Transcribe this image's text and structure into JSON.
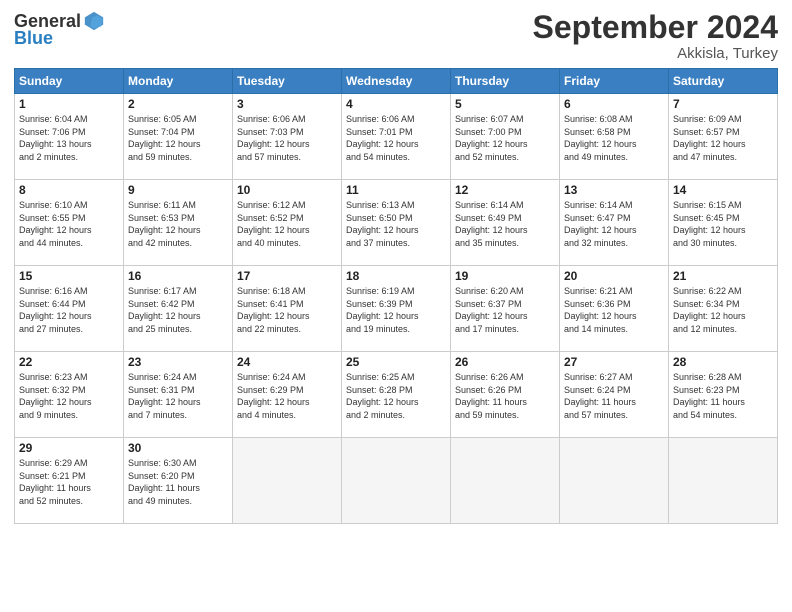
{
  "logo": {
    "general": "General",
    "blue": "Blue"
  },
  "title": "September 2024",
  "location": "Akkisla, Turkey",
  "days_header": [
    "Sunday",
    "Monday",
    "Tuesday",
    "Wednesday",
    "Thursday",
    "Friday",
    "Saturday"
  ],
  "weeks": [
    [
      {
        "day": "1",
        "lines": [
          "Sunrise: 6:04 AM",
          "Sunset: 7:06 PM",
          "Daylight: 13 hours",
          "and 2 minutes."
        ]
      },
      {
        "day": "2",
        "lines": [
          "Sunrise: 6:05 AM",
          "Sunset: 7:04 PM",
          "Daylight: 12 hours",
          "and 59 minutes."
        ]
      },
      {
        "day": "3",
        "lines": [
          "Sunrise: 6:06 AM",
          "Sunset: 7:03 PM",
          "Daylight: 12 hours",
          "and 57 minutes."
        ]
      },
      {
        "day": "4",
        "lines": [
          "Sunrise: 6:06 AM",
          "Sunset: 7:01 PM",
          "Daylight: 12 hours",
          "and 54 minutes."
        ]
      },
      {
        "day": "5",
        "lines": [
          "Sunrise: 6:07 AM",
          "Sunset: 7:00 PM",
          "Daylight: 12 hours",
          "and 52 minutes."
        ]
      },
      {
        "day": "6",
        "lines": [
          "Sunrise: 6:08 AM",
          "Sunset: 6:58 PM",
          "Daylight: 12 hours",
          "and 49 minutes."
        ]
      },
      {
        "day": "7",
        "lines": [
          "Sunrise: 6:09 AM",
          "Sunset: 6:57 PM",
          "Daylight: 12 hours",
          "and 47 minutes."
        ]
      }
    ],
    [
      {
        "day": "8",
        "lines": [
          "Sunrise: 6:10 AM",
          "Sunset: 6:55 PM",
          "Daylight: 12 hours",
          "and 44 minutes."
        ]
      },
      {
        "day": "9",
        "lines": [
          "Sunrise: 6:11 AM",
          "Sunset: 6:53 PM",
          "Daylight: 12 hours",
          "and 42 minutes."
        ]
      },
      {
        "day": "10",
        "lines": [
          "Sunrise: 6:12 AM",
          "Sunset: 6:52 PM",
          "Daylight: 12 hours",
          "and 40 minutes."
        ]
      },
      {
        "day": "11",
        "lines": [
          "Sunrise: 6:13 AM",
          "Sunset: 6:50 PM",
          "Daylight: 12 hours",
          "and 37 minutes."
        ]
      },
      {
        "day": "12",
        "lines": [
          "Sunrise: 6:14 AM",
          "Sunset: 6:49 PM",
          "Daylight: 12 hours",
          "and 35 minutes."
        ]
      },
      {
        "day": "13",
        "lines": [
          "Sunrise: 6:14 AM",
          "Sunset: 6:47 PM",
          "Daylight: 12 hours",
          "and 32 minutes."
        ]
      },
      {
        "day": "14",
        "lines": [
          "Sunrise: 6:15 AM",
          "Sunset: 6:45 PM",
          "Daylight: 12 hours",
          "and 30 minutes."
        ]
      }
    ],
    [
      {
        "day": "15",
        "lines": [
          "Sunrise: 6:16 AM",
          "Sunset: 6:44 PM",
          "Daylight: 12 hours",
          "and 27 minutes."
        ]
      },
      {
        "day": "16",
        "lines": [
          "Sunrise: 6:17 AM",
          "Sunset: 6:42 PM",
          "Daylight: 12 hours",
          "and 25 minutes."
        ]
      },
      {
        "day": "17",
        "lines": [
          "Sunrise: 6:18 AM",
          "Sunset: 6:41 PM",
          "Daylight: 12 hours",
          "and 22 minutes."
        ]
      },
      {
        "day": "18",
        "lines": [
          "Sunrise: 6:19 AM",
          "Sunset: 6:39 PM",
          "Daylight: 12 hours",
          "and 19 minutes."
        ]
      },
      {
        "day": "19",
        "lines": [
          "Sunrise: 6:20 AM",
          "Sunset: 6:37 PM",
          "Daylight: 12 hours",
          "and 17 minutes."
        ]
      },
      {
        "day": "20",
        "lines": [
          "Sunrise: 6:21 AM",
          "Sunset: 6:36 PM",
          "Daylight: 12 hours",
          "and 14 minutes."
        ]
      },
      {
        "day": "21",
        "lines": [
          "Sunrise: 6:22 AM",
          "Sunset: 6:34 PM",
          "Daylight: 12 hours",
          "and 12 minutes."
        ]
      }
    ],
    [
      {
        "day": "22",
        "lines": [
          "Sunrise: 6:23 AM",
          "Sunset: 6:32 PM",
          "Daylight: 12 hours",
          "and 9 minutes."
        ]
      },
      {
        "day": "23",
        "lines": [
          "Sunrise: 6:24 AM",
          "Sunset: 6:31 PM",
          "Daylight: 12 hours",
          "and 7 minutes."
        ]
      },
      {
        "day": "24",
        "lines": [
          "Sunrise: 6:24 AM",
          "Sunset: 6:29 PM",
          "Daylight: 12 hours",
          "and 4 minutes."
        ]
      },
      {
        "day": "25",
        "lines": [
          "Sunrise: 6:25 AM",
          "Sunset: 6:28 PM",
          "Daylight: 12 hours",
          "and 2 minutes."
        ]
      },
      {
        "day": "26",
        "lines": [
          "Sunrise: 6:26 AM",
          "Sunset: 6:26 PM",
          "Daylight: 11 hours",
          "and 59 minutes."
        ]
      },
      {
        "day": "27",
        "lines": [
          "Sunrise: 6:27 AM",
          "Sunset: 6:24 PM",
          "Daylight: 11 hours",
          "and 57 minutes."
        ]
      },
      {
        "day": "28",
        "lines": [
          "Sunrise: 6:28 AM",
          "Sunset: 6:23 PM",
          "Daylight: 11 hours",
          "and 54 minutes."
        ]
      }
    ],
    [
      {
        "day": "29",
        "lines": [
          "Sunrise: 6:29 AM",
          "Sunset: 6:21 PM",
          "Daylight: 11 hours",
          "and 52 minutes."
        ]
      },
      {
        "day": "30",
        "lines": [
          "Sunrise: 6:30 AM",
          "Sunset: 6:20 PM",
          "Daylight: 11 hours",
          "and 49 minutes."
        ]
      },
      {
        "day": "",
        "lines": []
      },
      {
        "day": "",
        "lines": []
      },
      {
        "day": "",
        "lines": []
      },
      {
        "day": "",
        "lines": []
      },
      {
        "day": "",
        "lines": []
      }
    ]
  ]
}
